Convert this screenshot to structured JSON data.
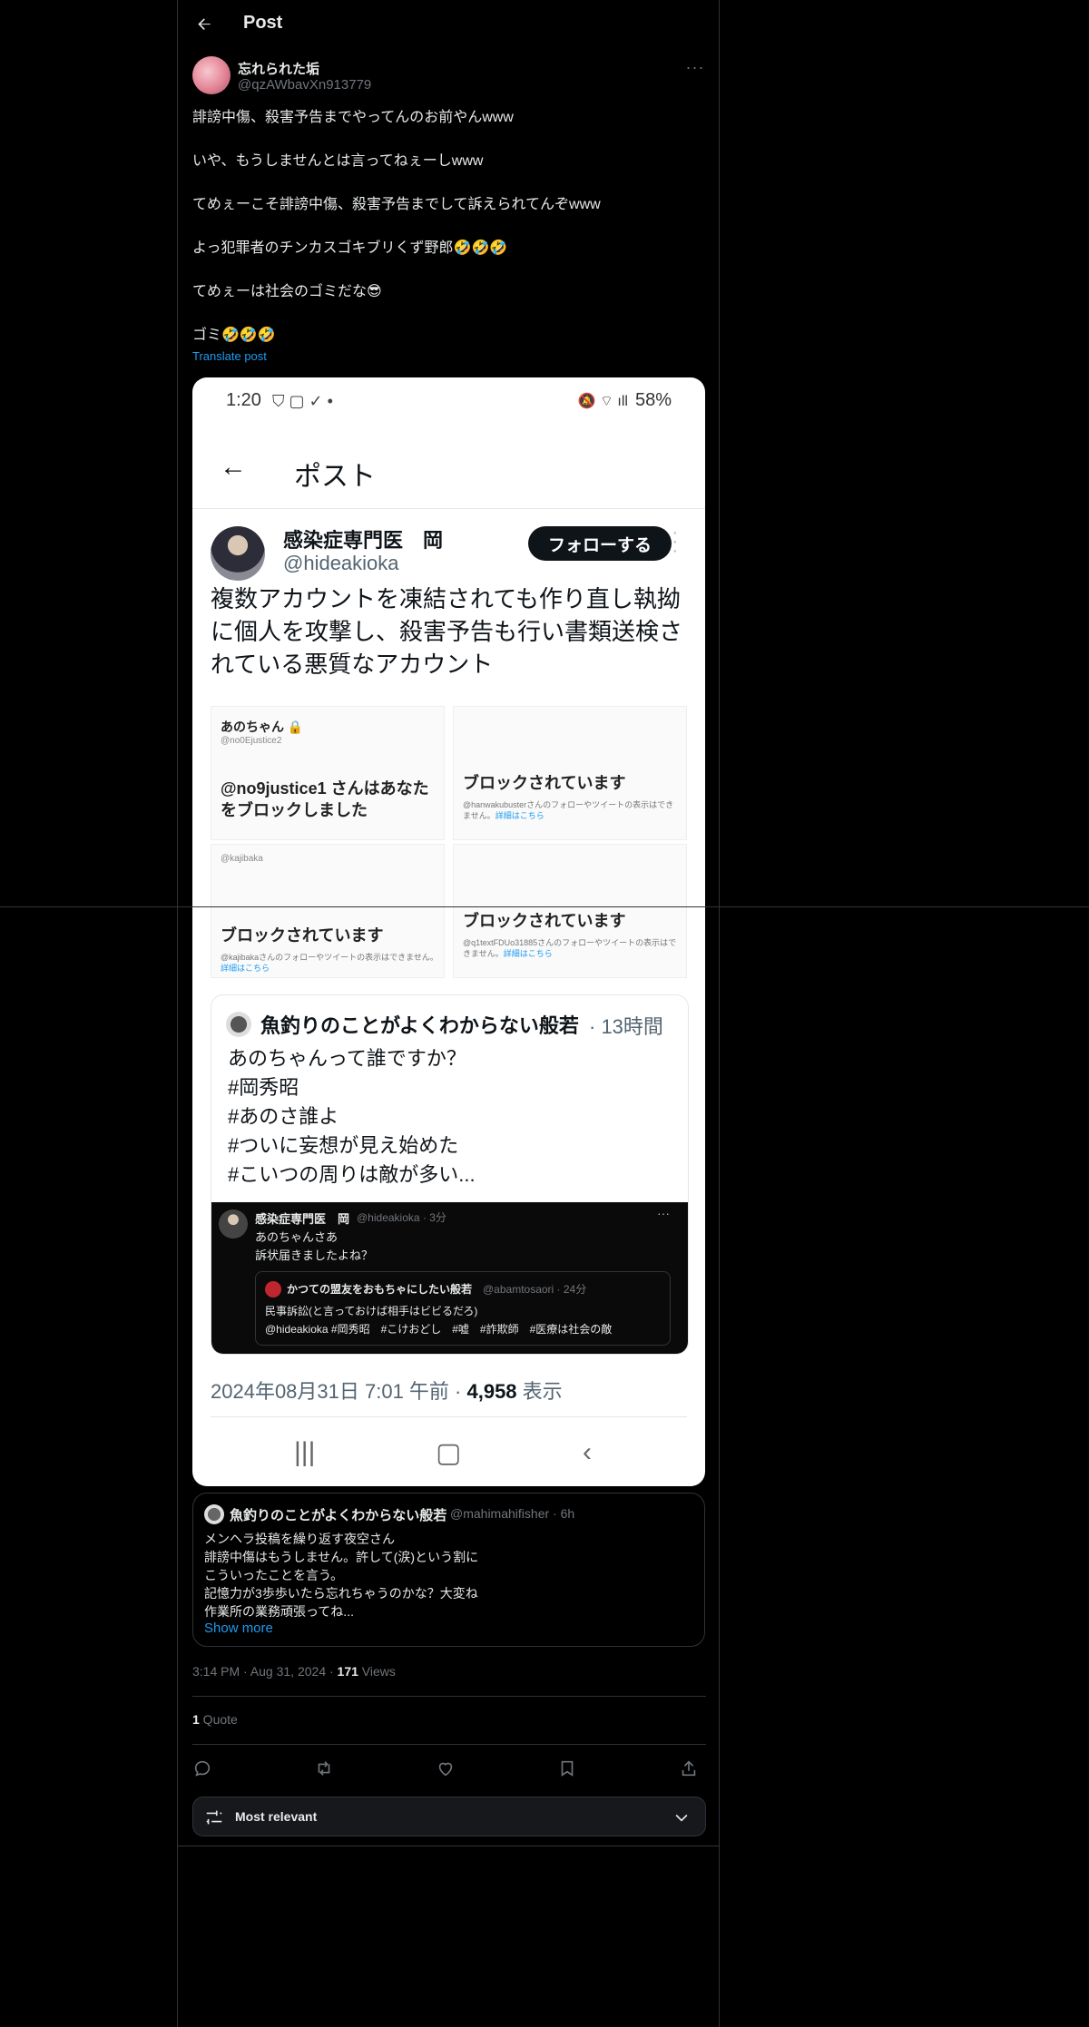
{
  "header": {
    "title": "Post"
  },
  "author": {
    "display_name": "忘れられた垢",
    "handle": "@qzAWbavXn913779"
  },
  "post": {
    "lines": [
      "誹謗中傷、殺害予告までやってんのお前やんwww",
      "いや、もうしませんとは言ってねぇーしwww",
      "てめぇーこそ誹謗中傷、殺害予告までして訴えられてんぞwww",
      "よっ犯罪者のチンカスゴキブリくず野郎🤣🤣🤣",
      "てめぇーは社会のゴミだな😎",
      "ゴミ🤣🤣🤣"
    ],
    "translate_label": "Translate post"
  },
  "screenshot": {
    "status_time": "1:20",
    "status_battery": "58%",
    "nav_title": "ポスト",
    "author_name": "感染症専門医　岡",
    "author_handle": "@hideakioka",
    "follow_label": "フォローする",
    "text": "複数アカウントを凍結されても作り直し執拗に個人を攻撃し、殺害予告も行い書類送検されている悪質なアカウント",
    "grid": [
      {
        "name": "あのちゃん 🔒",
        "handle": "@no0Ejustice2",
        "title": "@no9justice1 さんはあなたをブロックしました",
        "sub": "",
        "link": ""
      },
      {
        "name": "",
        "handle": "",
        "title": "ブロックされています",
        "sub": "@hanwakubusterさんのフォローやツイートの表示はできません。",
        "link": "詳細はこちら"
      },
      {
        "name": "",
        "handle": "@kajibaka",
        "title": "ブロックされています",
        "sub": "@kajibakaさんのフォローやツイートの表示はできません。",
        "link": "詳細はこちら"
      },
      {
        "name": "",
        "handle": "",
        "title": "ブロックされています",
        "sub": "@q1textFDUo31885さんのフォローやツイートの表示はできません。",
        "link": "詳細はこちら"
      }
    ],
    "quote": {
      "name": "魚釣りのことがよくわからない般若",
      "time": "· 13時間",
      "lines": [
        "あのちゃんって誰ですか？",
        "#岡秀昭",
        "#あのさ誰よ",
        "#ついに妄想が見え始めた",
        "#こいつの周りは敵が多い..."
      ],
      "inner": {
        "name": "感染症専門医　岡",
        "handle": "@hideakioka · 3分",
        "lines": [
          "あのちゃんさあ",
          "訴状届きましたよね？"
        ],
        "quote_name": "かつての盟友をおもちゃにしたい般若",
        "quote_handle": "@abamtosaori · 24分",
        "quote_lines": [
          "民事訴訟(と言っておけば相手はビビるだろ)",
          "@hideakioka #岡秀昭　#こけおどし　#嘘　#詐欺師　#医療は社会の敵"
        ]
      }
    },
    "meta_prefix": "2024年08月31日 7:01 午前 · ",
    "meta_views": "4,958",
    "meta_suffix": " 表示"
  },
  "quote_tweet": {
    "name": "魚釣りのことがよくわからない般若",
    "handle": "@mahimahifisher · 6h",
    "lines": [
      "メンヘラ投稿を繰り返す夜空さん",
      "誹謗中傷はもうしません。許して(涙)という割に",
      "こういったことを言う。",
      "記憶力が3歩歩いたら忘れちゃうのかな？大変ね",
      "作業所の業務頑張ってね..."
    ],
    "show_more": "Show more"
  },
  "meta": {
    "time": "3:14 PM · Aug 31, 2024 · ",
    "views": "171",
    "views_label": " Views"
  },
  "quotes": {
    "count": "1",
    "label": " Quote"
  },
  "sort": {
    "label": "Most relevant"
  },
  "icons": [
    "back-arrow-icon",
    "more-icon",
    "reply-icon",
    "repost-icon",
    "like-icon",
    "bookmark-icon",
    "share-icon",
    "sort-icon",
    "chevron-down-icon"
  ],
  "colors": {
    "background": "#000000",
    "text": "#e7e9ea",
    "muted": "#71767b",
    "link": "#1d9bf0",
    "border": "#2f3336"
  }
}
